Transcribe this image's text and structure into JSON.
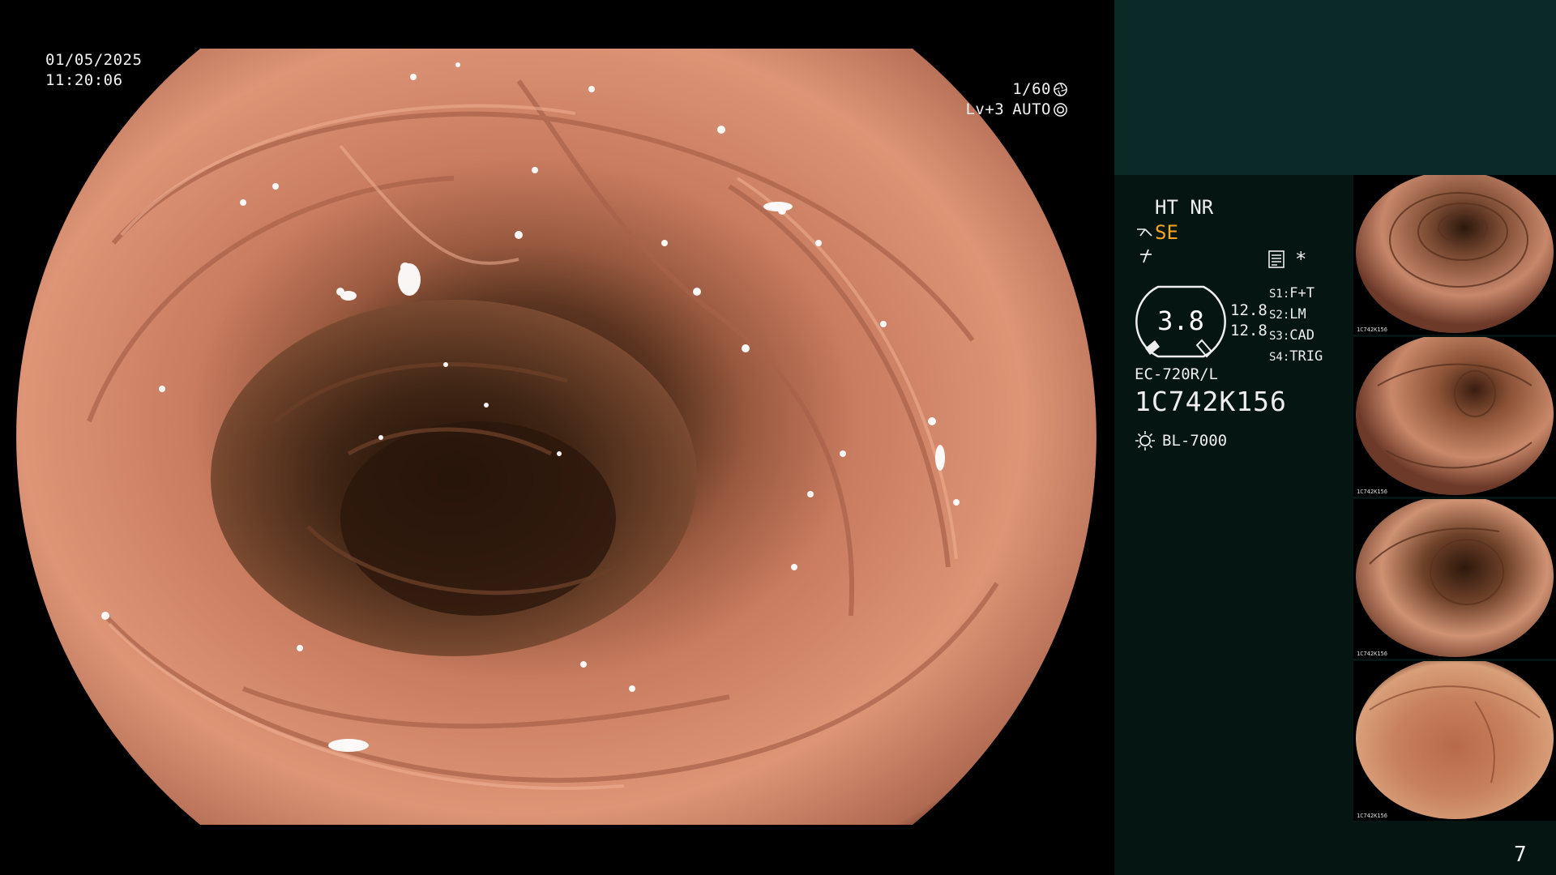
{
  "main_view": {
    "date": "01/05/2025",
    "time": "11:20:06",
    "shutter": "1/60",
    "shutter_icon": "aperture-icon",
    "level": "Lv+3",
    "mode": "AUTO",
    "mode_icon": "iris-icon"
  },
  "status": {
    "ht": "HT",
    "nr": "NR",
    "se": "SE",
    "se_icon": "structure-enhancement-icon",
    "enhancement_icon": "color-enhancement-icon",
    "capture_icons": [
      "storage-icon",
      "asterisk-icon"
    ],
    "asterisk": "*",
    "gauge_value": "3.8",
    "ratio_top": "12.8",
    "ratio_bottom": "12.8",
    "scope_switches": [
      {
        "key": "S1:",
        "value": "F+T"
      },
      {
        "key": "S2:",
        "value": "LM"
      },
      {
        "key": "S3:",
        "value": "CAD"
      },
      {
        "key": "S4:",
        "value": "TRIG"
      }
    ],
    "scope_model": "EC-720R/L",
    "serial": "1C742K156",
    "light_source": "BL-7000",
    "light_icon": "lamp-icon"
  },
  "thumbnails": [
    {
      "caption": "1C742K156"
    },
    {
      "caption": "1C742K156"
    },
    {
      "caption": "1C742K156"
    },
    {
      "caption": "1C742K156"
    }
  ],
  "page_number": "7",
  "colors": {
    "panel_bg": "#041512",
    "panel_top_band": "#0b2a27",
    "accent_orange": "#f6a623",
    "tissue": "#d98a6c",
    "lumen": "#3a1f12"
  }
}
